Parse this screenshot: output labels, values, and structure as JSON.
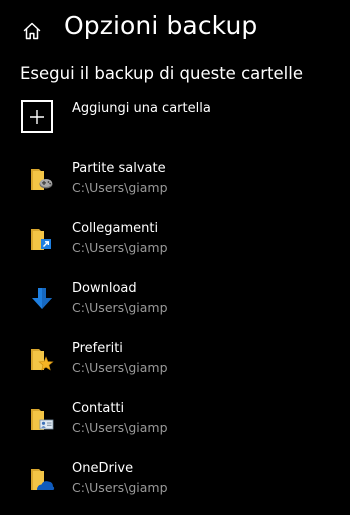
{
  "header": {
    "title": "Opzioni backup",
    "home_icon": "home-icon"
  },
  "section": {
    "title": "Esegui il backup di queste cartelle"
  },
  "add_folder": {
    "label": "Aggiungi una cartella",
    "icon": "plus-icon"
  },
  "folders": [
    {
      "name": "Partite salvate",
      "path": "C:\\Users\\giamp",
      "icon": "saved-games-folder-icon"
    },
    {
      "name": "Collegamenti",
      "path": "C:\\Users\\giamp",
      "icon": "links-folder-icon"
    },
    {
      "name": "Download",
      "path": "C:\\Users\\giamp",
      "icon": "download-arrow-icon"
    },
    {
      "name": "Preferiti",
      "path": "C:\\Users\\giamp",
      "icon": "favorites-folder-icon"
    },
    {
      "name": "Contatti",
      "path": "C:\\Users\\giamp",
      "icon": "contacts-folder-icon"
    },
    {
      "name": "OneDrive",
      "path": "C:\\Users\\giamp",
      "icon": "onedrive-folder-icon"
    }
  ],
  "colors": {
    "background": "#000000",
    "text": "#ffffff",
    "secondary_text": "#9a9a9a",
    "folder_yellow": "#f3c546",
    "download_blue": "#1e7fe0"
  }
}
